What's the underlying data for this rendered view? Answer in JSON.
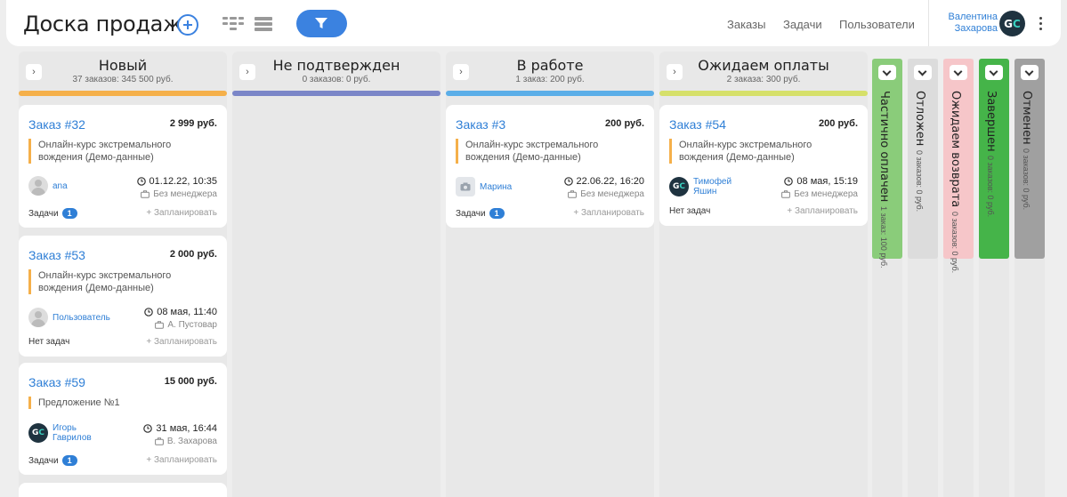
{
  "header": {
    "title": "Доска продаж",
    "nav": [
      "Заказы",
      "Задачи",
      "Пользователи"
    ],
    "user_name": "Валентина Захарова",
    "avatar_initials": "GC",
    "accent": "#3b82e0"
  },
  "columns": [
    {
      "title": "Новый",
      "subtitle": "37 заказов: 345 500 руб.",
      "color": "#f5b04a",
      "cards": [
        {
          "title": "Заказ #32",
          "price": "2 999 руб.",
          "desc": "Онлайн-курс экстремального вождения (Демо-данные)",
          "user": "ana",
          "date": "01.12.22, 10:35",
          "manager": "Без менеджера",
          "tasks": "Задачи",
          "task_count": "1",
          "plan": "+ Запланировать"
        },
        {
          "title": "Заказ #53",
          "price": "2 000 руб.",
          "desc": "Онлайн-курс экстремального вождения (Демо-данные)",
          "user": "Пользователь",
          "date": "08 мая, 11:40",
          "manager": "А. Пустовар",
          "tasks": "Нет задач",
          "plan": "+ Запланировать"
        },
        {
          "title": "Заказ #59",
          "price": "15 000 руб.",
          "desc": "Предложение №1",
          "user": "Игорь Гаврилов",
          "date": "31 мая, 16:44",
          "manager": "В. Захарова",
          "tasks": "Задачи",
          "task_count": "1",
          "plan": "+ Запланировать"
        }
      ]
    },
    {
      "title": "Не подтвержден",
      "subtitle": "0 заказов: 0 руб.",
      "color": "#7b86c8",
      "cards": []
    },
    {
      "title": "В работе",
      "subtitle": "1 заказ: 200 руб.",
      "color": "#5baee8",
      "cards": [
        {
          "title": "Заказ #3",
          "price": "200 руб.",
          "desc": "Онлайн-курс экстремального вождения (Демо-данные)",
          "user": "Марина",
          "date": "22.06.22, 16:20",
          "manager": "Без менеджера",
          "tasks": "Задачи",
          "task_count": "1",
          "plan": "+ Запланировать"
        }
      ]
    },
    {
      "title": "Ожидаем оплаты",
      "subtitle": "2 заказа: 300 руб.",
      "color": "#d6e06a",
      "cards": [
        {
          "title": "Заказ #54",
          "price": "200 руб.",
          "desc": "Онлайн-курс экстремального вождения (Демо-данные)",
          "user": "Тимофей Яшин",
          "date": "08 мая, 15:19",
          "manager": "Без менеджера",
          "tasks": "Нет задач",
          "plan": "+ Запланировать"
        }
      ]
    }
  ],
  "collapsed": [
    {
      "title": "Частично оплачен",
      "subtitle": "1 заказ: 100 руб.",
      "color": "#8acc7a"
    },
    {
      "title": "Отложен",
      "subtitle": "0 заказов: 0 руб.",
      "color": "#dcdcdc"
    },
    {
      "title": "Ожидаем возврата",
      "subtitle": "0 заказов: 0 руб.",
      "color": "#f6c6c9"
    },
    {
      "title": "Завершен",
      "subtitle": "0 заказов: 0 руб.",
      "color": "#45b449"
    },
    {
      "title": "Отменен",
      "subtitle": "0 заказов: 0 руб.",
      "color": "#a0a0a0"
    }
  ]
}
